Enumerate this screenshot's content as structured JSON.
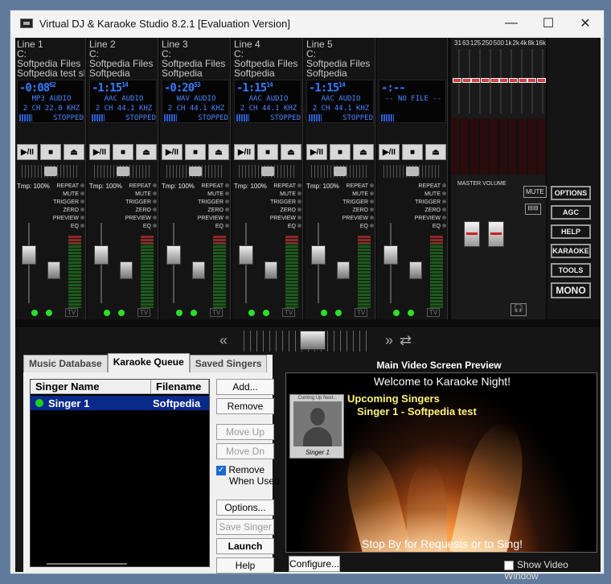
{
  "window": {
    "title": "Virtual DJ & Karaoke Studio 8.2.1 [Evaluation Version]",
    "minimize": "—",
    "maximize": "☐",
    "close": "✕"
  },
  "decks": [
    {
      "label": "Line 1",
      "drive": "C:",
      "folder": "Softpedia Files",
      "track": "Softpedia test sl",
      "time": "-0:08",
      "time_frac": "62",
      "format": "MP3 AUDIO",
      "info": "2 CH 22.0 KHZ",
      "status": "STOPPED",
      "tempo": "Tmp: 100%"
    },
    {
      "label": "Line 2",
      "drive": "C:",
      "folder": "Softpedia Files",
      "track": "Softpedia",
      "time": "-1:15",
      "time_frac": "14",
      "format": "AAC AUDIO",
      "info": "2 CH 44.1 KHZ",
      "status": "STOPPED",
      "tempo": "Tmp: 100%"
    },
    {
      "label": "Line 3",
      "drive": "C:",
      "folder": "Softpedia Files",
      "track": "Softpedia",
      "time": "-0:20",
      "time_frac": "53",
      "format": "WAV AUDIO",
      "info": "2 CH 44.1 KHZ",
      "status": "STOPPED",
      "tempo": "Tmp: 100%"
    },
    {
      "label": "Line 4",
      "drive": "C:",
      "folder": "Softpedia Files",
      "track": "Softpedia",
      "time": "-1:15",
      "time_frac": "14",
      "format": "AAC AUDIO",
      "info": "2 CH 44.1 KHZ",
      "status": "STOPPED",
      "tempo": "Tmp: 100%"
    },
    {
      "label": "Line 5",
      "drive": "C:",
      "folder": "Softpedia Files",
      "track": "Softpedia",
      "time": "-1:15",
      "time_frac": "14",
      "format": "AAC AUDIO",
      "info": "2 CH 44.1 KHZ",
      "status": "STOPPED",
      "tempo": "Tmp: 100%"
    },
    {
      "label": "",
      "drive": "",
      "folder": "",
      "track": "",
      "time": "-:--",
      "time_frac": "",
      "format": "-- NO FILE --",
      "info": "",
      "status": "",
      "tempo": ""
    }
  ],
  "deck_flags": [
    "REPEAT",
    "MUTE",
    "TRIGGER",
    "ZERO",
    "PREVIEW",
    "EQ"
  ],
  "deck_controls": {
    "play": "▶/II",
    "stop": "■",
    "eject": "⏏",
    "tv": "TV"
  },
  "eq": {
    "bands": [
      "31",
      "63",
      "125",
      "250",
      "500",
      "1k",
      "2k",
      "4k",
      "8k",
      "16k"
    ],
    "master_label": "MASTER VOLUME",
    "mute_label": "MUTE",
    "split_label": "⊟⊟"
  },
  "side_buttons": [
    "OPTIONS",
    "AGC",
    "HELP",
    "KARAOKE",
    "TOOLS",
    "MONO"
  ],
  "crossfader": {
    "left": "«",
    "right": "»",
    "swap": "⇄"
  },
  "karaoke": {
    "tabs": [
      "Music Database",
      "Karaoke Queue",
      "Saved Singers"
    ],
    "active_tab": 1,
    "columns": [
      "Singer Name",
      "Filename"
    ],
    "rows": [
      {
        "singer": "Singer 1",
        "file": "Softpedia"
      }
    ],
    "buttons": {
      "add": "Add...",
      "remove": "Remove",
      "move_up": "Move Up",
      "move_dn": "Move Dn",
      "options": "Options...",
      "save_singer": "Save Singer",
      "launch": "Launch",
      "help": "Help"
    },
    "remove_when_used_1": "Remove",
    "remove_when_used_2": "When Used"
  },
  "preview": {
    "title": "Main Video Screen Preview",
    "welcome": "Welcome to Karaoke Night!",
    "upcoming": "Upcoming Singers",
    "next_singer": "Singer 1 - Softpedia test",
    "card_caption": "Coming Up Next...",
    "card_name": "Singer 1",
    "footer": "Stop By for Requests or to Sing!",
    "configure": "Configure...",
    "show_video_window": "Show Video Window"
  }
}
